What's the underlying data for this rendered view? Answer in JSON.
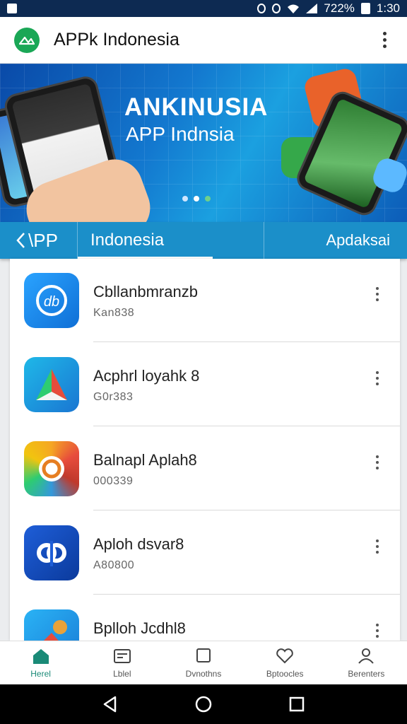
{
  "status_bar": {
    "battery_text": "722%",
    "time": "1:30"
  },
  "app_bar": {
    "title": "APPk Indonesia"
  },
  "banner": {
    "title": "ANKINUSIA",
    "subtitle": "APP Indnsia",
    "slide_count": 3,
    "active_slide": 2
  },
  "tab_strip": {
    "back_label": "\\PP",
    "active_tab": "Indonesia",
    "other_tab": "Apdaksai"
  },
  "apps": [
    {
      "name": "Cbllanbmranzb",
      "meta": "Kan838",
      "icon": "app-icon-blue-circle"
    },
    {
      "name": "Acphrl loyahk 8",
      "meta": "G0r383",
      "icon": "app-icon-triangle"
    },
    {
      "name": "Balnapl Aplah8",
      "meta": "000339",
      "icon": "app-icon-rainbow-ring"
    },
    {
      "name": "Aploh dsvar8",
      "meta": "A80800",
      "icon": "app-icon-blue-p"
    },
    {
      "name": "Bplloh Jcdhl8",
      "meta": "",
      "icon": "app-icon-fox"
    }
  ],
  "bottom_nav": [
    {
      "label": "Herel",
      "icon": "home-icon",
      "active": true
    },
    {
      "label": "Lblel",
      "icon": "list-icon",
      "active": false
    },
    {
      "label": "Dvnothns",
      "icon": "square-icon",
      "active": false
    },
    {
      "label": "Bptoocles",
      "icon": "heart-icon",
      "active": false
    },
    {
      "label": "Berenters",
      "icon": "person-icon",
      "active": false
    }
  ],
  "colors": {
    "accent": "#1b8fc9",
    "status_bar": "#0d2a52",
    "logo": "#1aa756",
    "nav_active": "#1a8a77"
  }
}
